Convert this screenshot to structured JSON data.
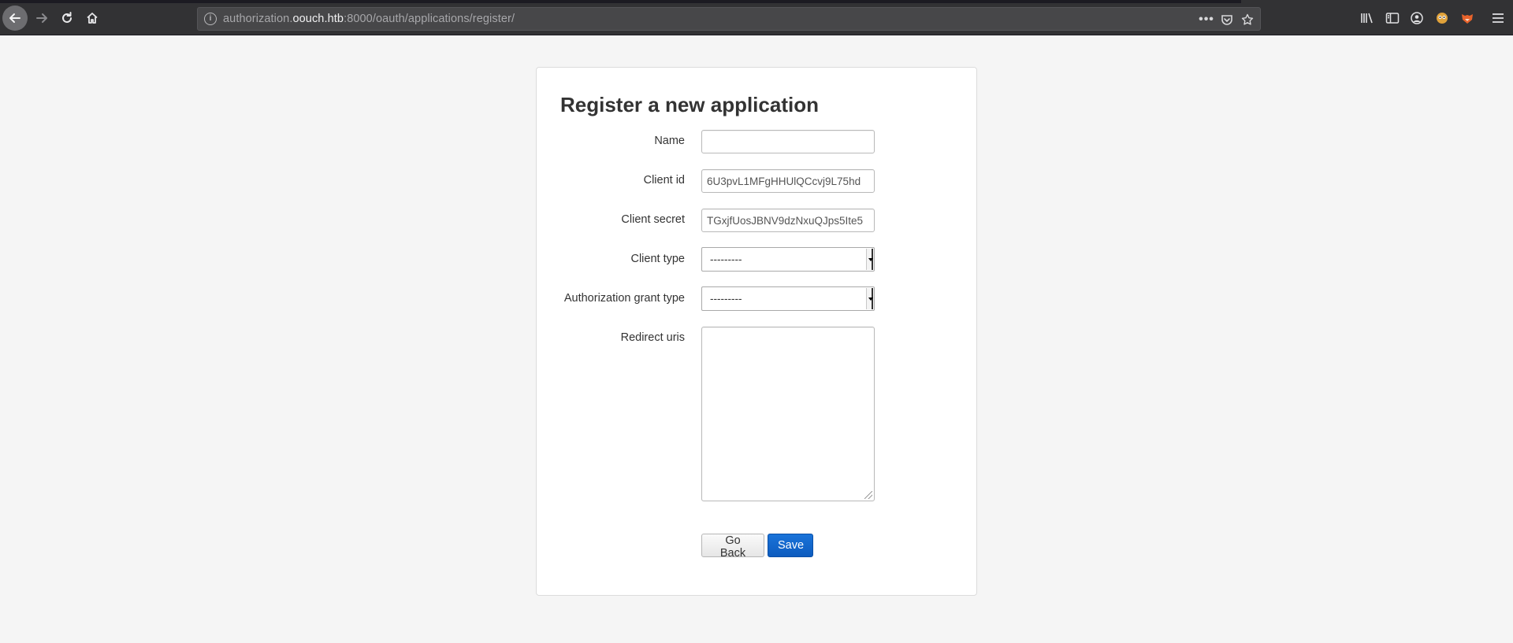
{
  "browser": {
    "url_prefix": "authorization.",
    "url_host": "oouch.htb",
    "url_rest": ":8000/oauth/applications/register/",
    "more_label": "•••"
  },
  "form": {
    "title": "Register a new application",
    "name_label": "Name",
    "name_value": "",
    "client_id_label": "Client id",
    "client_id_value": "6U3pvL1MFgHHUlQCcvj9L75hd",
    "client_secret_label": "Client secret",
    "client_secret_value": "TGxjfUosJBNV9dzNxuQJps5Ite5",
    "client_type_label": "Client type",
    "client_type_value": "---------",
    "grant_type_label": "Authorization grant type",
    "grant_type_value": "---------",
    "redirect_uris_label": "Redirect uris",
    "redirect_uris_value": "",
    "go_back_label": "Go Back",
    "save_label": "Save"
  },
  "colors": {
    "page_bg": "#f5f5f5",
    "toolbar_bg": "#323234",
    "primary_button": "#1a6fd5"
  }
}
